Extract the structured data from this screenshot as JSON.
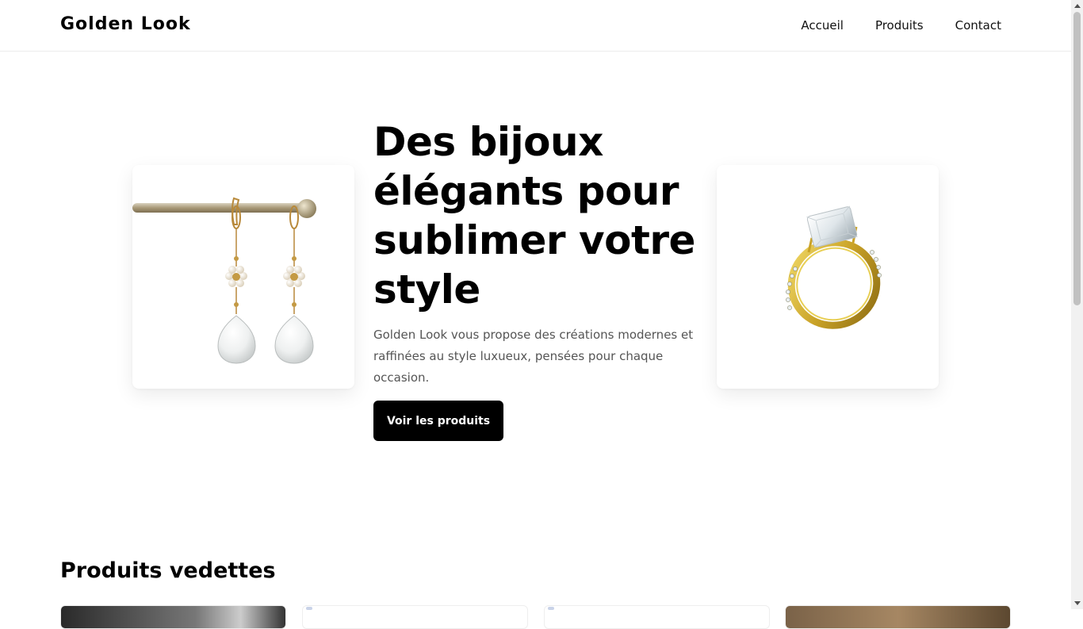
{
  "header": {
    "logo": "Golden Look",
    "nav": [
      {
        "label": "Accueil"
      },
      {
        "label": "Produits"
      },
      {
        "label": "Contact"
      }
    ]
  },
  "hero": {
    "title": "Des bijoux élégants pour sublimer votre style",
    "description": "Golden Look vous propose des créations modernes et raffinées au style luxueux, pensées pour chaque occasion.",
    "cta_label": "Voir les produits",
    "left_image": "pearl-drop-earrings",
    "right_image": "gold-diamond-ring"
  },
  "featured": {
    "title": "Produits vedettes"
  },
  "colors": {
    "accent": "#000000",
    "gold": "#c9a227",
    "text_muted": "#555555"
  }
}
